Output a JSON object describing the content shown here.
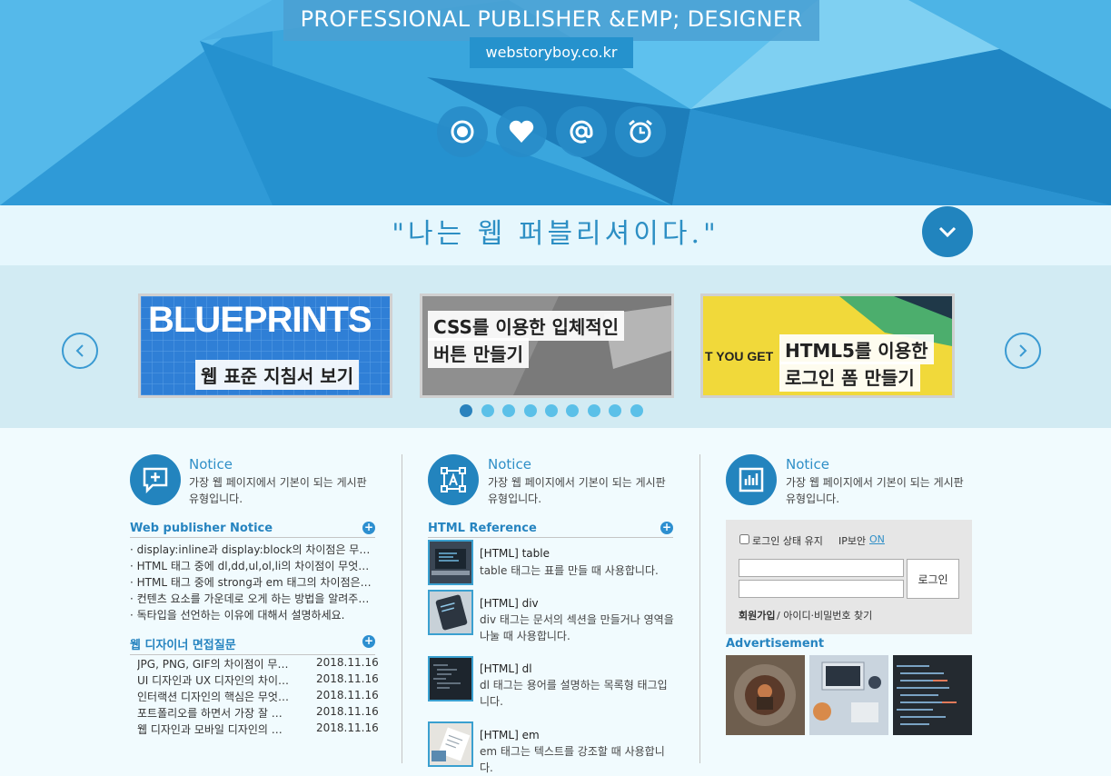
{
  "header": {
    "title": "PROFESSIONAL PUBLISHER &EMP; DESIGNER",
    "url": "webstoryboy.co.kr",
    "social_icons": [
      "target-icon",
      "heart-icon",
      "at-icon",
      "alarm-icon"
    ]
  },
  "quote": {
    "text": "\"나는 웹 퍼블리셔이다.\""
  },
  "slider": {
    "slides": [
      {
        "line1": "BLUEPRINTS",
        "line2": "웹 표준 지침서 보기"
      },
      {
        "line1": "CSS를 이용한 입체적인",
        "line2": "버튼 만들기"
      },
      {
        "line1": "HTML5를 이용한",
        "line2": "로그인 폼 만들기",
        "side": "T YOU GET"
      }
    ],
    "dot_count": 9,
    "active_dot": 0
  },
  "columns": [
    {
      "title": "Notice",
      "desc_line1": "가장 웹 페이지에서 기본이 되는 게시판",
      "desc_line2": "유형입니다.",
      "icon": "chat-plus-icon"
    },
    {
      "title": "Notice",
      "desc_line1": "가장 웹 페이지에서 기본이 되는 게시판",
      "desc_line2": "유형입니다.",
      "icon": "text-frame-icon"
    },
    {
      "title": "Notice",
      "desc_line1": "가장 웹 페이지에서 기본이 되는 게시판",
      "desc_line2": "유형입니다.",
      "icon": "bar-chart-icon"
    }
  ],
  "publisher_notice": {
    "title": "Web publisher Notice",
    "items": [
      "· display:inline과 display:block의 차이점은 무엇인가요?",
      "· HTML 태그 중에 dl,dd,ul,ol,li의 차이점이 무엇인가요?",
      "· HTML 태그 중에 strong과 em 태그의 차이점은 무엇인가요?",
      "· 컨텐츠 요소를 가운데로 오게 하는 방법을 알려주세요.",
      "· 독타입을 선언하는 이유에 대해서 설명하세요."
    ]
  },
  "interview": {
    "title": "웹 디자이너 면접질문",
    "items": [
      {
        "text": "JPG, PNG, GIF의 차이점이 무엇인가요?",
        "date": "2018.11.16"
      },
      {
        "text": "UI 디자인과 UX 디자인의 차이점은?",
        "date": "2018.11.16"
      },
      {
        "text": "인터랙션 디자인의 핵심은 무엇인가요?",
        "date": "2018.11.16"
      },
      {
        "text": "포트폴리오를 하면서 가장 잘 한 작업은?",
        "date": "2018.11.16"
      },
      {
        "text": "웹 디자인과 모바일 디자인의 차이점은?",
        "date": "2018.11.16"
      }
    ]
  },
  "html_reference": {
    "title": "HTML Reference",
    "items": [
      {
        "title": "[HTML] table",
        "desc": "table 태그는 표를 만들 때 사용합니다."
      },
      {
        "title": "[HTML] div",
        "desc": "div 태그는 문서의 섹션을 만들거나 영역을 나눌 때 사용합니다."
      },
      {
        "title": "[HTML] dl",
        "desc": "dl 태그는 용어를 설명하는 목록형 태그입니다."
      },
      {
        "title": "[HTML] em",
        "desc": "em 태그는 텍스트를 강조할 때 사용합니다."
      }
    ]
  },
  "login": {
    "keep_label": "로그인 상태 유지",
    "ip_label": "IP보안",
    "ip_on": "ON",
    "button": "로그인",
    "join": "회원가입",
    "find": " / 아이디·비밀번호 찾기"
  },
  "advertisement": {
    "title": "Advertisement"
  },
  "colors": {
    "primary": "#2384be",
    "accent": "#2f8fc7",
    "header_bg": "#3aa6dd"
  }
}
